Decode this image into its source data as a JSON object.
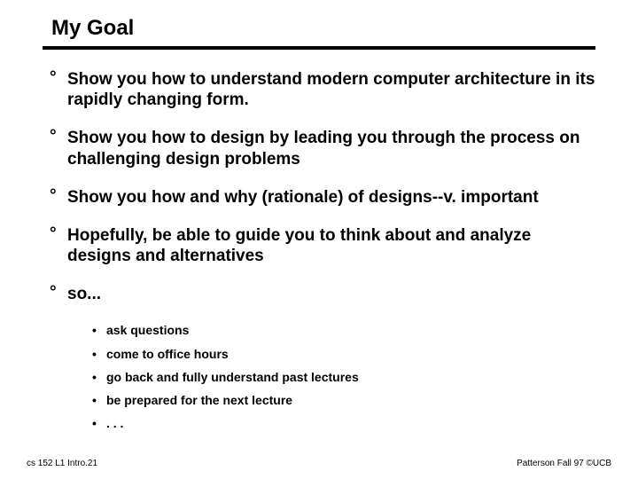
{
  "title": "My Goal",
  "bullets": [
    "Show you how to understand modern computer architecture in its rapidly changing form.",
    "Show you how to design by leading you through the process on challenging design problems",
    "Show you how and why (rationale) of designs--v. important",
    "Hopefully, be able to guide you to think about and analyze designs and alternatives",
    "so..."
  ],
  "sub_bullets": [
    "ask questions",
    "come to office hours",
    "go back and fully understand past lectures",
    "be prepared for the next lecture",
    ". . ."
  ],
  "footer": {
    "left": "cs 152 L1 Intro.21",
    "right": "Patterson Fall 97 ©UCB"
  }
}
